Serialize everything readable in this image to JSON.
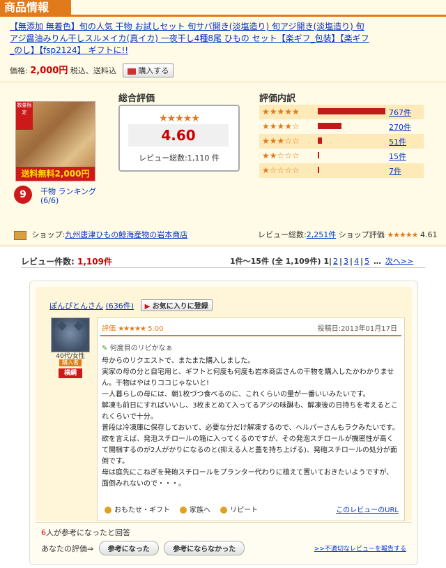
{
  "header": {
    "title": "商品情報"
  },
  "product": {
    "title": "【無添加 無着色】旬の人気 干物 お試しセット 旬サバ開き(淡塩造り) 旬アジ開き(淡塩造り) 旬アジ醤油みりん干しスルメイカ(真イカ) 一夜干し4種8尾 ひもの セット【楽ギフ_包装】【楽ギフ_のし】【fsp2124】 ギフトに!!",
    "price_label": "価格:",
    "price": "2,000円",
    "price_note": "税込、送料込",
    "buy_button": "購入する",
    "thumb_badge": "数量限定",
    "thumb_banner": "送料無料2,000円"
  },
  "ranking": {
    "rank": "9",
    "label": "干物 ランキング",
    "sub": "(6/6)"
  },
  "overall": {
    "heading": "総合評価",
    "stars": "★★★★★",
    "score": "4.60",
    "total": "レビュー総数:1,110 件"
  },
  "breakdown": {
    "heading": "評価内訳",
    "rows": [
      {
        "stars": "★★★★★",
        "count": "767件",
        "pct": 0.691
      },
      {
        "stars": "★★★★☆",
        "count": "270件",
        "pct": 0.243
      },
      {
        "stars": "★★★☆☆",
        "count": "51件",
        "pct": 0.046
      },
      {
        "stars": "★★☆☆☆",
        "count": "15件",
        "pct": 0.014
      },
      {
        "stars": "★☆☆☆☆",
        "count": "7件",
        "pct": 0.006
      }
    ]
  },
  "shop": {
    "label": "ショップ:",
    "name": "九州唐津ひもの鯨海産物の岩本商店",
    "total_label": "レビュー総数:",
    "total": "2,251件",
    "rating_label": "ショップ評価",
    "rating_stars": "★★★★★",
    "rating": "4.61"
  },
  "reviews_header": {
    "label": "レビュー件数:",
    "count": "1,109件",
    "range": "1件〜15件 (全 1,109件)",
    "pages": [
      "1",
      "2",
      "3",
      "4",
      "5"
    ],
    "ellipsis": "…",
    "next": "次へ>>"
  },
  "review": {
    "user": "ぽんぴとんさん",
    "user_count": "(636件)",
    "fav": "お気に入りに登録",
    "age": "40代/女性",
    "badge1": "購入者",
    "badge2": "横綱",
    "eval_label": "評価",
    "eval_stars": "★★★★★",
    "eval_score": "5.00",
    "date": "投稿日:2013年01月17日",
    "title": "何度目のリピかなぁ",
    "body": [
      "母からのリクエストで、またまた購入しました。",
      "実家の母の分と自宅用と、ギフトと何度も何度も岩本商店さんの干物を購入したかわかりません。干物はやはりココじゃないと!",
      "一人暮らしの母には、朝1枚づつ食べるのに、これくらいの量が一番いいみたいです。",
      "解凍も前日にすればいいし、3枚まとめて入ってるアジの味醂も、解凍後の日持ちを考えるとこれくらいで十分。",
      "普段は冷凍庫に保存しておいて、必要な分だけ解凍するので、ヘルパーさんもラクみたいです。",
      "欲を言えば、発泡スチロールの箱に入ってくるのですが、その発泡スチロールが機密性が高くて開梱するのが2人がかりになるのと(抑える人と蓋を持ち上げる)、発砲スチロールの処分が面倒です。",
      "母は庭先にこねぎを発砲スチロールをプランター代わりに植えて置いておきたいようですが、面倒みれないので・・・。"
    ],
    "tags": [
      "おもたせ・ギフト",
      "家族へ",
      "リピート"
    ],
    "url_link": "このレビューのURL",
    "helpful_count": "6",
    "helpful_text": "人が参考になったと回答",
    "your_rate": "あなたの評価⇒",
    "vote_yes": "参考になった",
    "vote_no": "参考にならなかった",
    "report": ">>不適切なレビューを報告する"
  }
}
